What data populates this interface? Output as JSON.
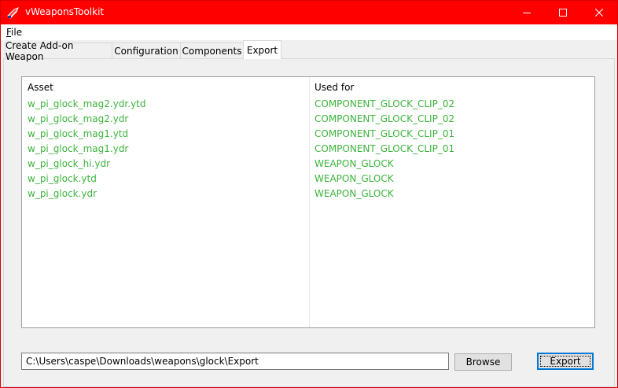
{
  "window": {
    "title": "vWeaponsToolkit",
    "accent_color": "#ff0000",
    "controls": [
      "minimize-icon",
      "maximize-icon",
      "close-icon"
    ]
  },
  "menu": {
    "items": [
      {
        "label": "File",
        "mnemonic": "F",
        "rest": "ile"
      }
    ]
  },
  "tabs": [
    {
      "label": "Create Add-on Weapon",
      "active": false
    },
    {
      "label": "Configuration",
      "active": false
    },
    {
      "label": "Components",
      "active": false
    },
    {
      "label": "Export",
      "active": true
    }
  ],
  "list": {
    "columns": [
      "Asset",
      "Used for"
    ],
    "text_color": "#3cb43c",
    "rows": [
      {
        "asset": "w_pi_glock_mag2.ydr.ytd",
        "used_for": "COMPONENT_GLOCK_CLIP_02"
      },
      {
        "asset": "w_pi_glock_mag2.ydr",
        "used_for": "COMPONENT_GLOCK_CLIP_02"
      },
      {
        "asset": "w_pi_glock_mag1.ytd",
        "used_for": "COMPONENT_GLOCK_CLIP_01"
      },
      {
        "asset": "w_pi_glock_mag1.ydr",
        "used_for": "COMPONENT_GLOCK_CLIP_01"
      },
      {
        "asset": "w_pi_glock_hi.ydr",
        "used_for": "WEAPON_GLOCK"
      },
      {
        "asset": "w_pi_glock.ytd",
        "used_for": "WEAPON_GLOCK"
      },
      {
        "asset": "w_pi_glock.ydr",
        "used_for": "WEAPON_GLOCK"
      }
    ]
  },
  "export_panel": {
    "path_value": "C:\\Users\\caspe\\Downloads\\weapons\\glock\\Export",
    "browse_label": "Browse",
    "export_label": "Export"
  }
}
